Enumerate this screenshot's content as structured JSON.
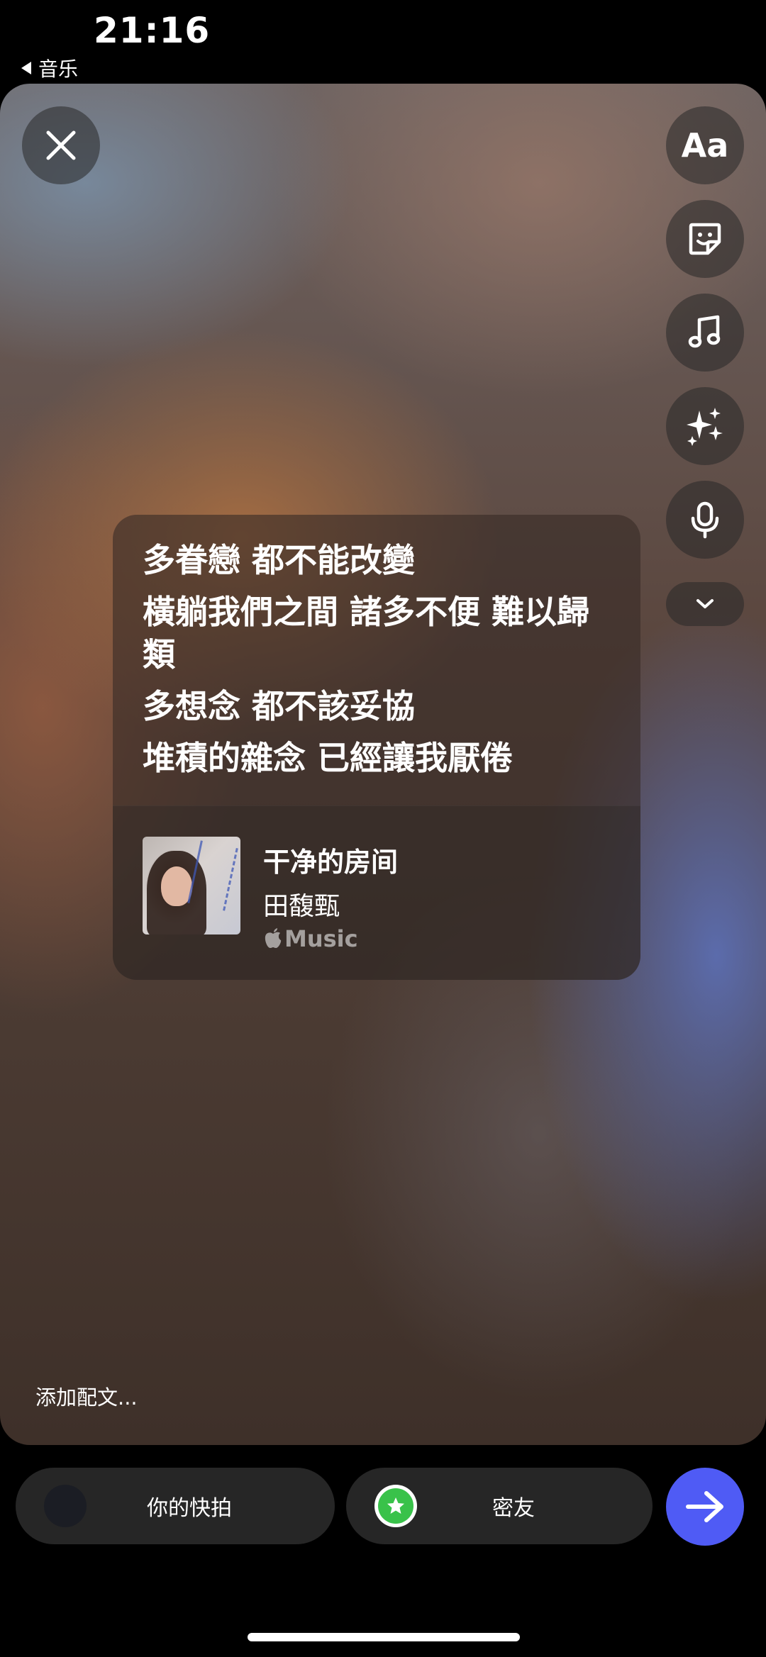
{
  "status_bar": {
    "time": "21:16",
    "back_app": "音乐"
  },
  "toolbar": {
    "text_tool_label": "Aa",
    "icons": [
      "close-icon",
      "sticker-icon",
      "music-note-icon",
      "sparkles-icon",
      "microphone-icon",
      "chevron-down-icon"
    ]
  },
  "lyrics_card": {
    "lines": [
      "多眷戀 都不能改變",
      "橫躺我們之間 諸多不便 難以歸類",
      "多想念 都不該妥協",
      "堆積的雜念 已經讓我厭倦"
    ],
    "song": {
      "title": "干净的房间",
      "artist": "田馥甄",
      "service": "Music"
    }
  },
  "caption": {
    "placeholder": "添加配文..."
  },
  "bottom_bar": {
    "your_story_label": "你的快拍",
    "close_friends_label": "密友"
  },
  "colors": {
    "send_button": "#4f5bf5",
    "close_friends_badge": "#39c24a",
    "pill_background": "#262626"
  }
}
